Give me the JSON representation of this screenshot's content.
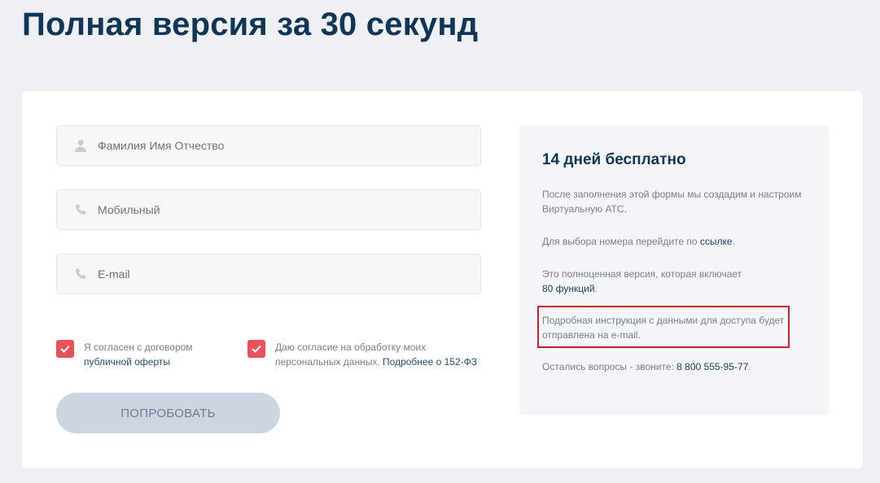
{
  "page": {
    "title": "Полная версия за 30 секунд"
  },
  "form": {
    "name_placeholder": "Фамилия Имя Отчество",
    "phone_placeholder": "Мобильный",
    "email_placeholder": "E-mail",
    "consent1": {
      "text": "Я согласен с договором",
      "link": "публичной оферты"
    },
    "consent2": {
      "text": "Даю согласие на обработку моих персональных данных.",
      "link": "Подробнее о 152-ФЗ"
    },
    "submit_label": "ПОПРОБОВАТЬ"
  },
  "info": {
    "title": "14 дней бесплатно",
    "p1": "После заполнения этой формы мы создадим и настроим Виртуальную АТС.",
    "p2_text": "Для выбора номера перейдите по",
    "p2_link": "ссылке",
    "p3_text": "Это полноценная версия, которая включает",
    "p3_link": "80 функций",
    "p4": "Подробная инструкция с данными для доступа будет отправлена на e-mail.",
    "p5_text": "Остались вопросы - звоните:",
    "p5_phone": "8 800 555-95-77"
  },
  "colors": {
    "title": "#0f3557",
    "checkbox": "#e8525a",
    "highlight": "#c7202e",
    "button": "#cdd6e0"
  }
}
